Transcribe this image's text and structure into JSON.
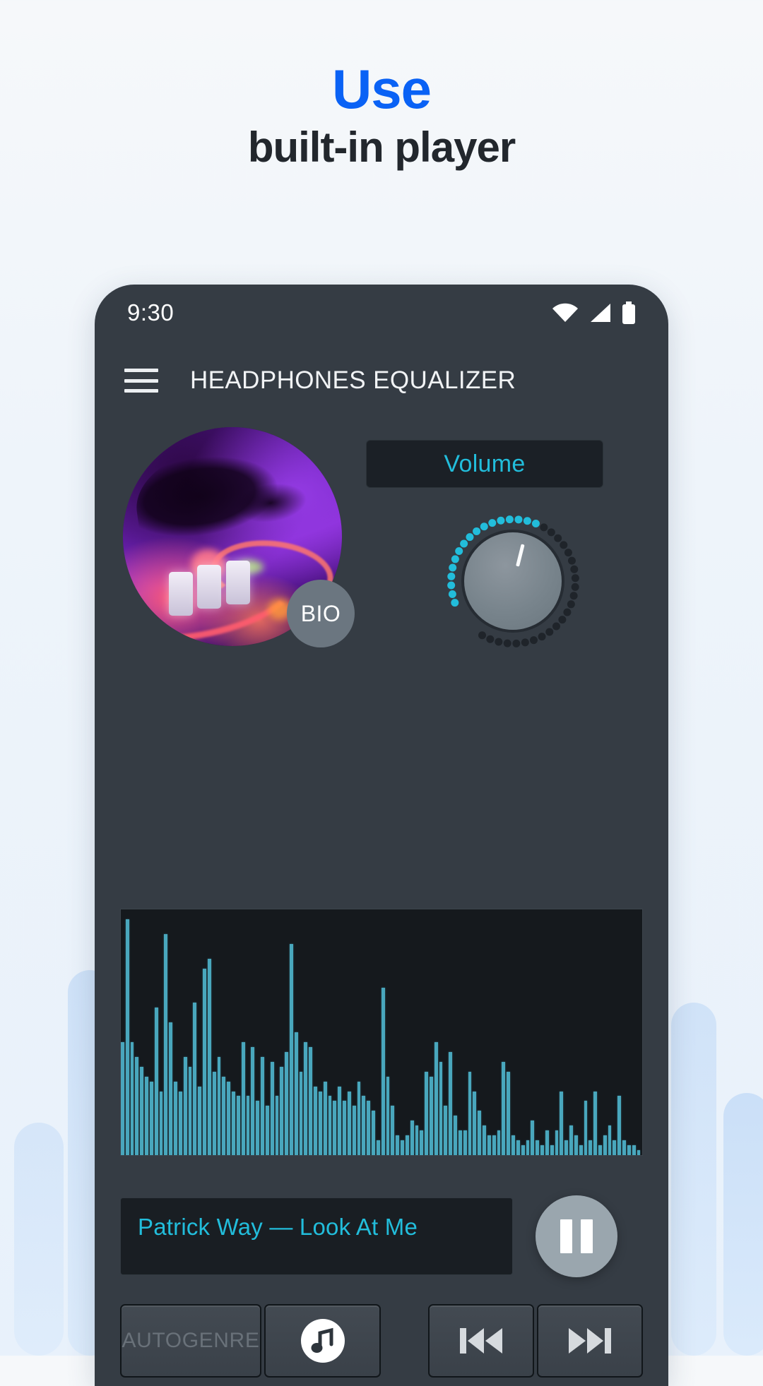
{
  "headline": {
    "line1": "Use",
    "line2": "built-in player",
    "accent_color": "#0a62f5",
    "text_color": "#22272d"
  },
  "background": {
    "color_top": "#f6f8fa",
    "color_bottom": "#e8f1fb",
    "decor_bar_color": "#cfe2f8"
  },
  "phone": {
    "frame_color": "#353c44",
    "statusbar": {
      "time": "9:30",
      "icons": [
        "wifi-icon",
        "cellular-signal-icon",
        "battery-icon"
      ]
    },
    "appbar": {
      "menu_icon": "hamburger-menu-icon",
      "title": "HEADPHONES EQUALIZER"
    },
    "album": {
      "bio_badge_label": "BIO",
      "art_description": "dj-mixer-artwork"
    },
    "volume": {
      "label": "Volume",
      "accent_color": "#22bddb",
      "knob_total_dots": 40,
      "knob_active_dots": 17,
      "knob_indicator_angle_deg": 14
    },
    "spectrum": {
      "bar_color": "#49a7bd",
      "background": "#15191d",
      "values": [
        46,
        96,
        46,
        40,
        36,
        32,
        30,
        60,
        26,
        90,
        54,
        30,
        26,
        40,
        36,
        62,
        28,
        76,
        80,
        34,
        40,
        32,
        30,
        26,
        24,
        46,
        24,
        44,
        22,
        40,
        20,
        38,
        24,
        36,
        42,
        86,
        50,
        34,
        46,
        44,
        28,
        26,
        30,
        24,
        22,
        28,
        22,
        26,
        20,
        30,
        24,
        22,
        18,
        6,
        68,
        32,
        20,
        8,
        6,
        8,
        14,
        12,
        10,
        34,
        32,
        46,
        38,
        20,
        42,
        16,
        10,
        10,
        34,
        26,
        18,
        12,
        8,
        8,
        10,
        38,
        34,
        8,
        6,
        4,
        6,
        14,
        6,
        4,
        10,
        4,
        10,
        26,
        6,
        12,
        8,
        4,
        22,
        6,
        26,
        4,
        8,
        12,
        6,
        24,
        6,
        4,
        4,
        2
      ]
    },
    "track": {
      "title": "Patrick Way — Look At Me",
      "title_color": "#22bddb",
      "transport_button": "pause-button"
    },
    "controls": {
      "autogenre_label": "AUTOGENRE",
      "music_note_icon": "music-note-icon",
      "prev_icon": "skip-previous-icon",
      "next_icon": "skip-next-icon"
    }
  }
}
